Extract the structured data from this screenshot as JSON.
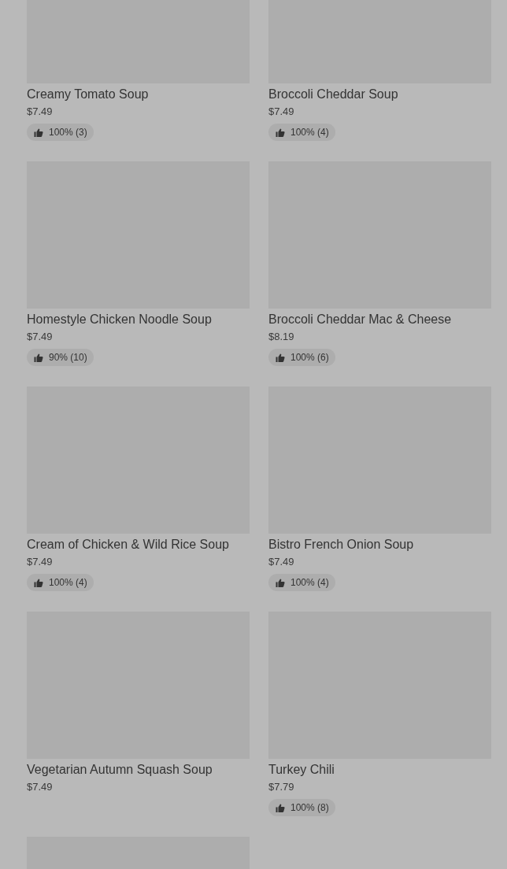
{
  "items": [
    {
      "kind": "product",
      "title": "Creamy Tomato Soup",
      "price": "$7.49",
      "rating": "100% (3)"
    },
    {
      "kind": "product",
      "title": "Broccoli Cheddar Soup",
      "price": "$7.49",
      "rating": "100% (4)"
    },
    {
      "kind": "product",
      "title": "Homestyle Chicken Noodle Soup",
      "price": "$7.49",
      "rating": "90% (10)"
    },
    {
      "kind": "product",
      "title": "Broccoli Cheddar Mac & Cheese",
      "price": "$8.19",
      "rating": "100% (6)"
    },
    {
      "kind": "product",
      "title": "Cream of Chicken & Wild Rice Soup",
      "price": "$7.49",
      "rating": "100% (4)"
    },
    {
      "kind": "product",
      "title": "Bistro French Onion Soup",
      "price": "$7.49",
      "rating": "100% (4)"
    },
    {
      "kind": "product",
      "title": "Vegetarian Autumn Squash Soup",
      "price": "$7.49"
    },
    {
      "kind": "product",
      "title": "Turkey Chili",
      "price": "$7.79",
      "rating": "100% (8)"
    },
    {
      "kind": "image_only"
    }
  ]
}
